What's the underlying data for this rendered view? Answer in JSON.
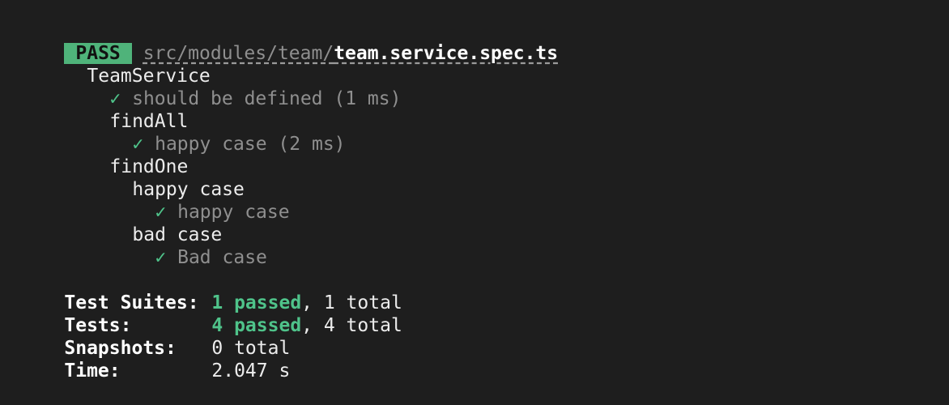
{
  "header": {
    "badge": "PASS",
    "path_dir": "src/modules/team/",
    "path_file": "team.service.spec.ts"
  },
  "tests": {
    "suite": "TeamService",
    "check_mark": "✓",
    "test1": "should be defined (1 ms)",
    "group_findall": "findAll",
    "test2": "happy case (2 ms)",
    "group_findone": "findOne",
    "subgroup_happy": "happy case",
    "test3": "happy case",
    "subgroup_bad": "bad case",
    "test4": "Bad case"
  },
  "summary": {
    "suites_label": "Test Suites:",
    "suites_passed": "1 passed",
    "suites_total": ", 1 total",
    "tests_label": "Tests:",
    "tests_passed": "4 passed",
    "tests_total": ", 4 total",
    "snapshots_label": "Snapshots:",
    "snapshots_value": "0 total",
    "time_label": "Time:",
    "time_value": "2.047 s"
  },
  "colors": {
    "background": "#1e1e1e",
    "pass_badge": "#4fb37a",
    "success": "#4fc38a",
    "dim_text": "#8f8f8f"
  }
}
